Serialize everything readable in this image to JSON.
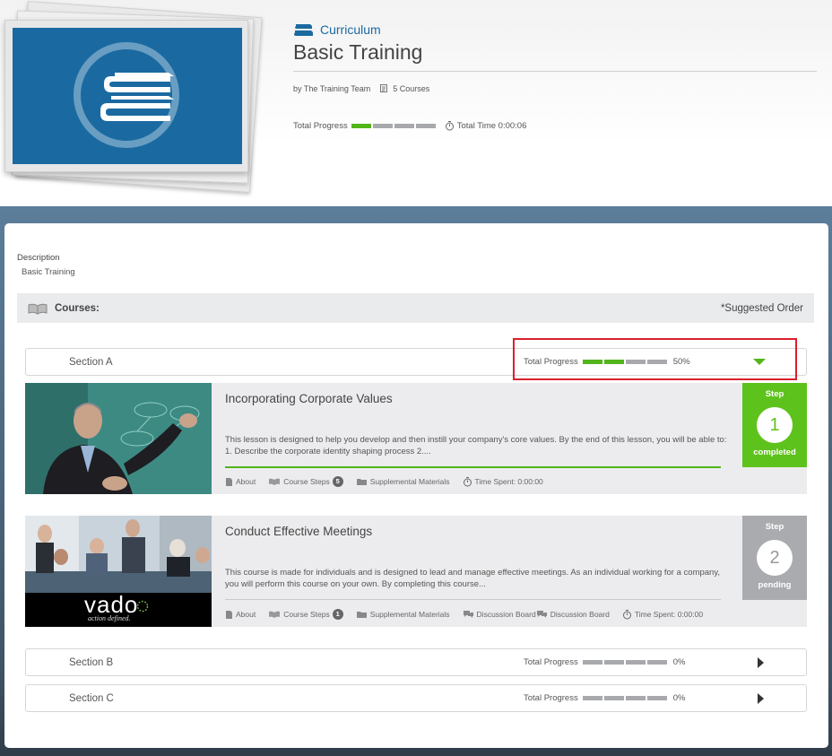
{
  "header": {
    "type_label": "Curriculum",
    "title": "Basic Training",
    "author": "by The Training Team",
    "course_count": "5 Courses",
    "progress_label": "Total Progress",
    "progress_fraction": 0.25,
    "time_label": "Total Time 0:00:06"
  },
  "description": {
    "label": "Description",
    "text": "Basic Training"
  },
  "courses_bar": {
    "title": "Courses:",
    "order_label": "*Suggested Order"
  },
  "sections": [
    {
      "name": "Section A",
      "progress_label": "Total Progress",
      "percent": "50%",
      "expanded": true
    },
    {
      "name": "Section B",
      "progress_label": "Total Progress",
      "percent": "0%",
      "expanded": false
    },
    {
      "name": "Section C",
      "progress_label": "Total Progress",
      "percent": "0%",
      "expanded": false
    }
  ],
  "courses": [
    {
      "title": "Incorporating Corporate Values",
      "description": "This lesson is designed to help you develop and then instill your company's core values. By the end of this lesson, you will be able to:  1. Describe the corporate identity shaping process 2....",
      "about": "About",
      "steps_label": "Course Steps",
      "steps_count": "5",
      "supplemental": "Supplemental Materials",
      "time_spent": "Time Spent: 0:00:00",
      "step_label": "Step",
      "step_number": "1",
      "step_status": "completed"
    },
    {
      "title": "Conduct Effective Meetings",
      "description": "This course is made for individuals and is designed to lead and manage effective meetings. As an individual working for a company, you will perform this course on your own. By completing this course...",
      "about": "About",
      "steps_label": "Course Steps",
      "steps_count": "1",
      "supplemental": "Supplemental Materials",
      "discussion_1": "Discussion Board",
      "discussion_2": "Discussion Board",
      "time_spent": "Time Spent: 0:00:00",
      "step_label": "Step",
      "step_number": "2",
      "step_status": "pending",
      "thumb_brand": "vado",
      "thumb_tagline": "action defined."
    }
  ],
  "colors": {
    "accent": "#1a6aa1",
    "progress_on": "#52b51b",
    "progress_off": "#a7a9ac",
    "step_completed": "#5ec21c",
    "step_pending": "#a9abae",
    "highlight": "#d9202c"
  }
}
